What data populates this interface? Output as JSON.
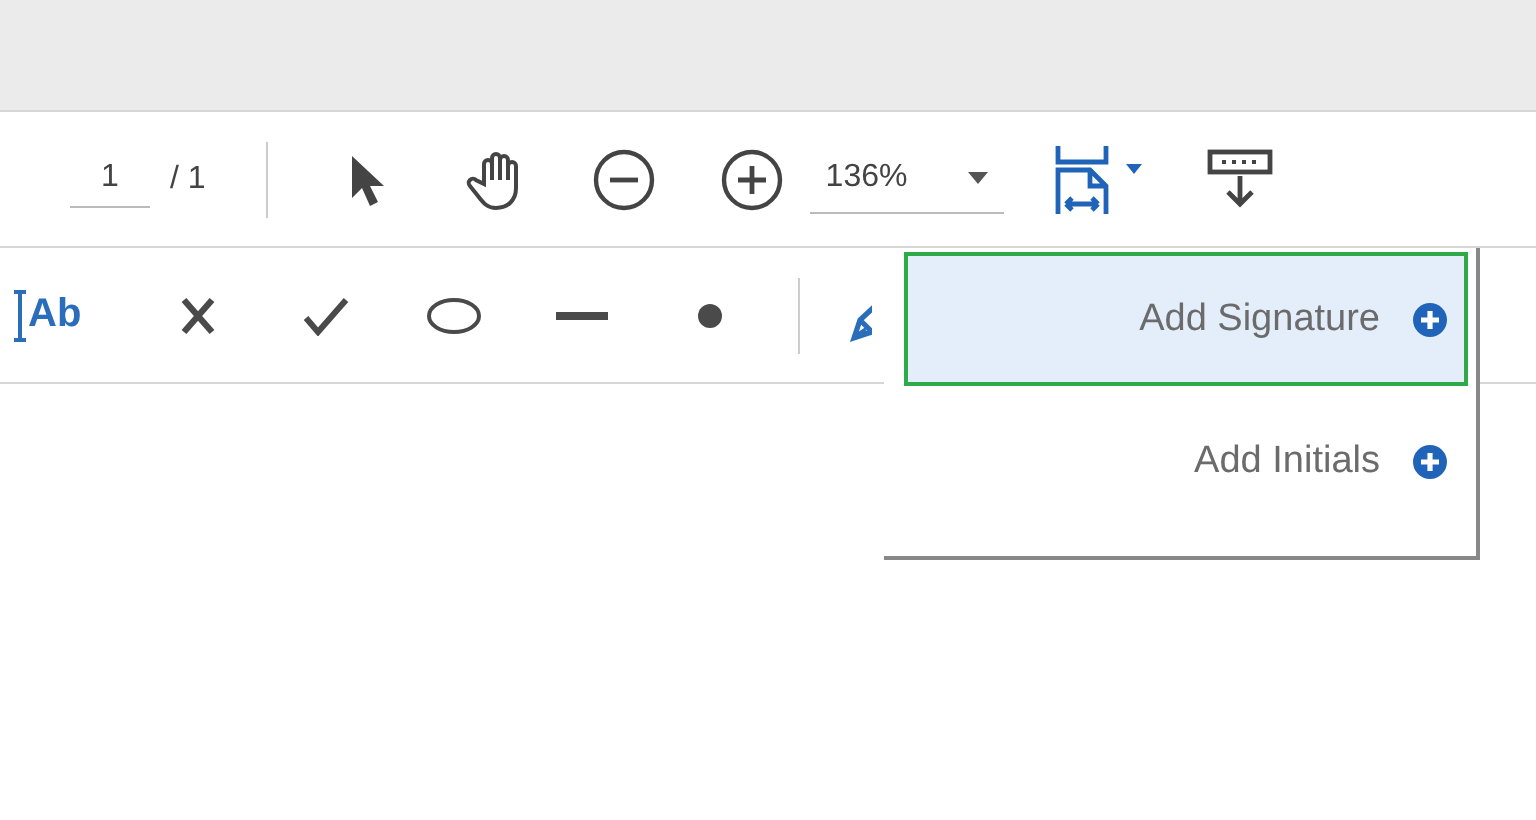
{
  "toolbar": {
    "page_number": "1",
    "page_total": "/ 1",
    "zoom": "136%"
  },
  "fill_sign_tools": [
    {
      "kind": "text",
      "label": "Ab"
    },
    {
      "kind": "cross"
    },
    {
      "kind": "check"
    },
    {
      "kind": "ellipse"
    },
    {
      "kind": "line"
    },
    {
      "kind": "dot"
    },
    {
      "kind": "sign"
    }
  ],
  "sign_menu": {
    "items": [
      {
        "label": "Add Signature",
        "selected": true
      },
      {
        "label": "Add Initials",
        "selected": false
      }
    ]
  }
}
